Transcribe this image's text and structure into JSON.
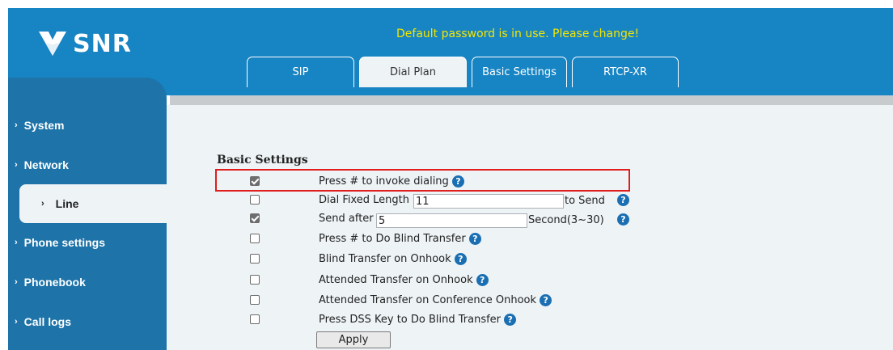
{
  "brand": {
    "name": "SNR"
  },
  "warning": "Default password is in use. Please change!",
  "tabs": [
    {
      "label": "SIP",
      "active": false
    },
    {
      "label": "Dial Plan",
      "active": true
    },
    {
      "label": "Basic Settings",
      "active": false
    },
    {
      "label": "RTCP-XR",
      "active": false
    }
  ],
  "sidebar": {
    "items": [
      {
        "label": "System",
        "active": false
      },
      {
        "label": "Network",
        "active": false
      },
      {
        "label": "Line",
        "active": true
      },
      {
        "label": "Phone settings",
        "active": false
      },
      {
        "label": "Phonebook",
        "active": false
      },
      {
        "label": "Call logs",
        "active": false
      }
    ]
  },
  "section_title": "Basic Settings",
  "options": {
    "invoke_dialing": {
      "label": "Press # to invoke dialing",
      "checked": true
    },
    "dial_fixed_length": {
      "label": "Dial Fixed Length",
      "value": "11",
      "suffix": "to Send",
      "checked": false
    },
    "send_after": {
      "label": "Send after",
      "value": "5",
      "suffix": "Second(3~30)",
      "checked": true
    },
    "blind_transfer": {
      "label": "Press # to Do Blind Transfer",
      "checked": false
    },
    "blind_onhook": {
      "label": "Blind Transfer on Onhook",
      "checked": false
    },
    "attended_onhook": {
      "label": "Attended Transfer on Onhook",
      "checked": false
    },
    "attended_conf_onhook": {
      "label": "Attended Transfer on Conference Onhook",
      "checked": false
    },
    "dss_blind": {
      "label": "Press DSS Key to Do Blind Transfer",
      "checked": false
    }
  },
  "help_glyph": "?",
  "apply_label": "Apply",
  "colors": {
    "header_blue": "#1784c3",
    "sidebar_blue": "#1e73a8",
    "warning_yellow": "#f5e600",
    "highlight_red": "#e01e1e"
  }
}
